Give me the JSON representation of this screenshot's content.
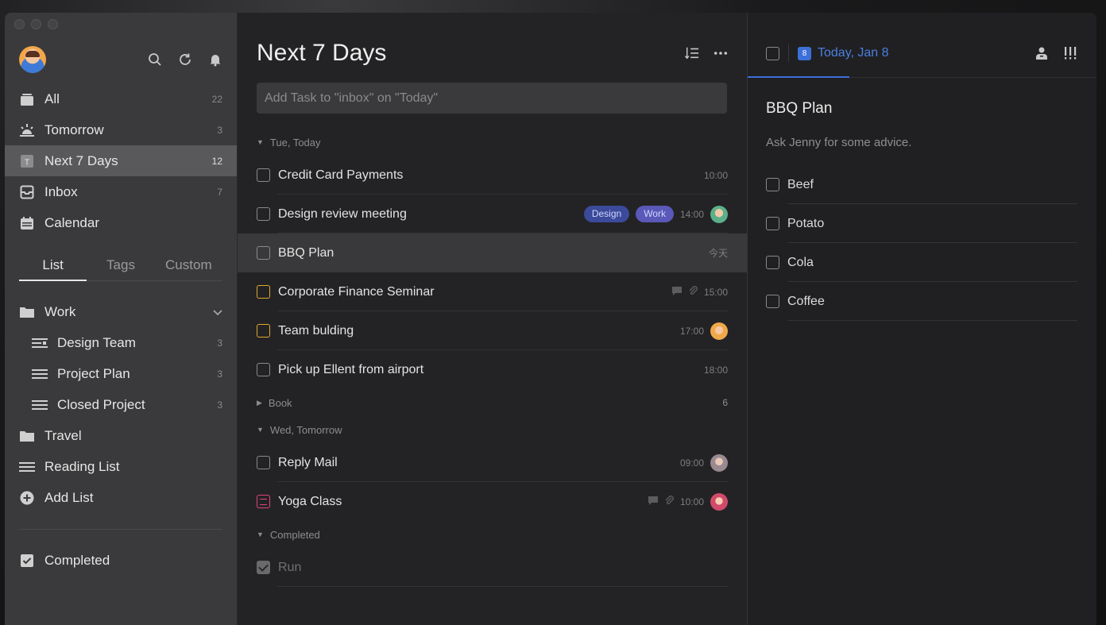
{
  "sidebar": {
    "nav": [
      {
        "label": "All",
        "count": "22",
        "icon": "all-icon"
      },
      {
        "label": "Tomorrow",
        "count": "3",
        "icon": "sunrise-icon"
      },
      {
        "label": "Next 7 Days",
        "count": "12",
        "icon": "week-icon"
      },
      {
        "label": "Inbox",
        "count": "7",
        "icon": "inbox-icon"
      },
      {
        "label": "Calendar",
        "count": "",
        "icon": "calendar-icon"
      }
    ],
    "tabs": [
      "List",
      "Tags",
      "Custom"
    ],
    "lists": [
      {
        "label": "Work",
        "count": "",
        "icon": "folder-icon"
      },
      {
        "label": "Design Team",
        "count": "3",
        "icon": "list-icon"
      },
      {
        "label": "Project Plan",
        "count": "3",
        "icon": "list-icon"
      },
      {
        "label": "Closed Project",
        "count": "3",
        "icon": "list-icon"
      },
      {
        "label": "Travel",
        "count": "",
        "icon": "folder-icon"
      },
      {
        "label": "Reading List",
        "count": "",
        "icon": "list-icon"
      },
      {
        "label": "Add List",
        "count": "",
        "icon": "plus-circle-icon"
      }
    ],
    "completed_label": "Completed"
  },
  "main": {
    "title": "Next 7 Days",
    "add_task_placeholder": "Add Task to \"inbox\" on \"Today\"",
    "sections": {
      "today": "Tue, Today",
      "book": "Book",
      "book_count": "6",
      "tomorrow": "Wed, Tomorrow",
      "completed": "Completed"
    },
    "tasks": [
      {
        "title": "Credit Card Payments",
        "time": "10:00"
      },
      {
        "title": "Design review meeting",
        "time": "14:00",
        "tags": [
          "Design",
          "Work"
        ]
      },
      {
        "title": "BBQ Plan",
        "time": "今天"
      },
      {
        "title": "Corporate Finance Seminar",
        "time": "15:00"
      },
      {
        "title": "Team bulding",
        "time": "17:00"
      },
      {
        "title": "Pick up Ellent from airport",
        "time": "18:00"
      },
      {
        "title": "Reply Mail",
        "time": "09:00"
      },
      {
        "title": "Yoga Class",
        "time": "10:00"
      },
      {
        "title": "Run",
        "time": ""
      }
    ]
  },
  "detail": {
    "date": "Today, Jan 8",
    "date_icon_text": "8",
    "title": "BBQ Plan",
    "description": "Ask Jenny for some advice.",
    "checklist": [
      "Beef",
      "Potato",
      "Cola",
      "Coffee"
    ]
  },
  "colors": {
    "accent": "#3c6fd8",
    "priority_medium": "#e0a830",
    "priority_high": "#e0457a"
  }
}
